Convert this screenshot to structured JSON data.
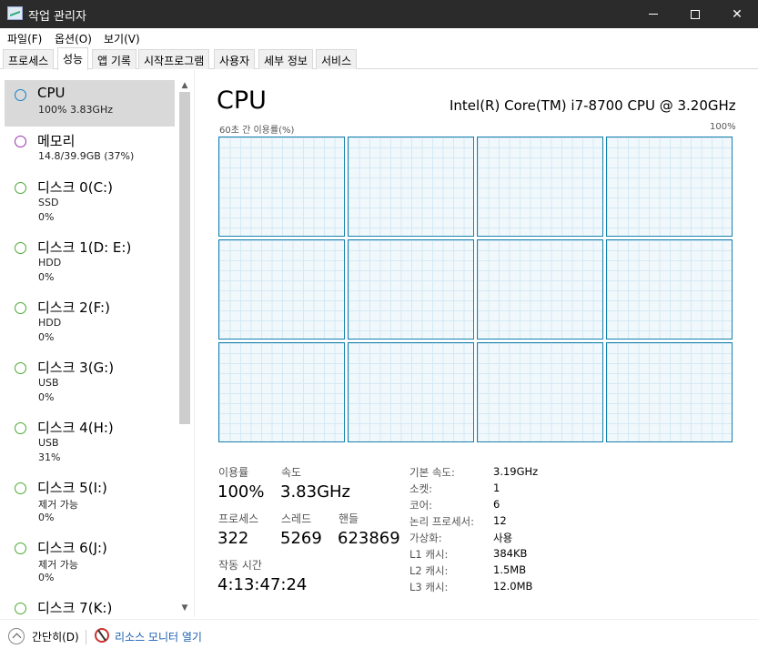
{
  "window": {
    "title": "작업 관리자",
    "minimize_icon": "minimize-icon",
    "maximize_icon": "maximize-icon",
    "close_icon": "close-icon",
    "close_glyph": "✕"
  },
  "menu": [
    {
      "label": "파일(F)"
    },
    {
      "label": "옵션(O)"
    },
    {
      "label": "보기(V)"
    }
  ],
  "tabs": [
    {
      "label": "프로세스",
      "active": false
    },
    {
      "label": "성능",
      "active": true
    },
    {
      "label": "앱 기록",
      "active": false
    },
    {
      "label": "시작프로그램",
      "active": false
    },
    {
      "label": "사용자",
      "active": false
    },
    {
      "label": "세부 정보",
      "active": false
    },
    {
      "label": "서비스",
      "active": false
    }
  ],
  "sidebar": {
    "items": [
      {
        "name": "CPU",
        "sub1": "100% 3.83GHz",
        "sub2": "",
        "color": "#1780c4"
      },
      {
        "name": "메모리",
        "sub1": "14.8/39.9GB (37%)",
        "sub2": "",
        "color": "#9b2fae"
      },
      {
        "name": "디스크 0(C:)",
        "sub1": "SSD",
        "sub2": "0%",
        "color": "#4da832"
      },
      {
        "name": "디스크 1(D: E:)",
        "sub1": "HDD",
        "sub2": "0%",
        "color": "#4da832"
      },
      {
        "name": "디스크 2(F:)",
        "sub1": "HDD",
        "sub2": "0%",
        "color": "#4da832"
      },
      {
        "name": "디스크 3(G:)",
        "sub1": "USB",
        "sub2": "0%",
        "color": "#4da832"
      },
      {
        "name": "디스크 4(H:)",
        "sub1": "USB",
        "sub2": "31%",
        "color": "#4da832"
      },
      {
        "name": "디스크 5(I:)",
        "sub1": "제거 가능",
        "sub2": "0%",
        "color": "#4da832"
      },
      {
        "name": "디스크 6(J:)",
        "sub1": "제거 가능",
        "sub2": "0%",
        "color": "#4da832"
      },
      {
        "name": "디스크 7(K:)",
        "sub1": "",
        "sub2": "",
        "color": "#4da832"
      }
    ]
  },
  "main": {
    "title": "CPU",
    "model": "Intel(R) Core(TM) i7-8700 CPU @ 3.20GHz",
    "graph_label": "60초 간 이용률(%)",
    "graph_max": "100%",
    "graph_count": 12,
    "stats": {
      "util_label": "이용률",
      "util_value": "100%",
      "speed_label": "속도",
      "speed_value": "3.83GHz",
      "proc_label": "프로세스",
      "proc_value": "322",
      "thread_label": "스레드",
      "thread_value": "5269",
      "handle_label": "핸들",
      "handle_value": "623869",
      "uptime_label": "작동 시간",
      "uptime_value": "4:13:47:24"
    },
    "info": [
      {
        "key": "기본 속도:",
        "value": "3.19GHz"
      },
      {
        "key": "소켓:",
        "value": "1"
      },
      {
        "key": "코어:",
        "value": "6"
      },
      {
        "key": "논리 프로세서:",
        "value": "12"
      },
      {
        "key": "가상화:",
        "value": "사용"
      },
      {
        "key": "L1 캐시:",
        "value": "384KB"
      },
      {
        "key": "L2 캐시:",
        "value": "1.5MB"
      },
      {
        "key": "L3 캐시:",
        "value": "12.0MB"
      }
    ]
  },
  "footer": {
    "collapse_label": "간단히(D)",
    "resmon_label": "리소스 모니터 열기"
  }
}
